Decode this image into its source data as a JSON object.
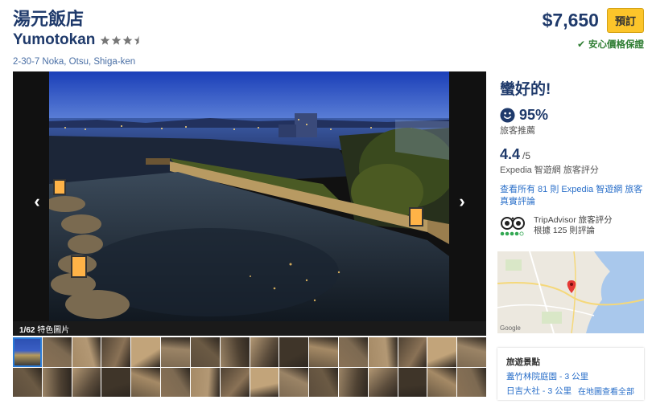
{
  "hotel": {
    "name_cn": "湯元飯店",
    "name_en": "Yumotokan",
    "star_rating": 3.5,
    "address": "2-30-7 Noka,  Otsu,  Shiga-ken"
  },
  "booking": {
    "price": "$7,650",
    "book_label": "預訂",
    "guarantee": "安心價格保證"
  },
  "gallery": {
    "counter": "1/62",
    "caption": "特色圖片",
    "thumbnail_count": 32,
    "active_thumbnail": 0
  },
  "reviews": {
    "headline": "蠻好的!",
    "recommend_pct": "95%",
    "recommend_label": "旅客推薦",
    "score": "4.4",
    "score_max": "/5",
    "score_label": "Expedia 智遊網 旅客評分",
    "all_reviews_link": "查看所有 81 則 Expedia 智遊網 旅客真實評論",
    "tripadvisor_label": "TripAdvisor 旅客評分",
    "tripadvisor_count": "根據 125 則評論"
  },
  "map": {
    "provider": "Google"
  },
  "attractions": {
    "title": "旅遊景點",
    "items": [
      "蓋竹林院庭園 - 3 公里",
      "日吉大社 - 3 公里"
    ],
    "view_map_link": "在地圖查看全部"
  },
  "colors": {
    "heading": "#1f3a6b",
    "link": "#2a6fc9",
    "book_button": "#fcc52a",
    "guarantee": "#2e7d32",
    "stars": "#777777"
  }
}
